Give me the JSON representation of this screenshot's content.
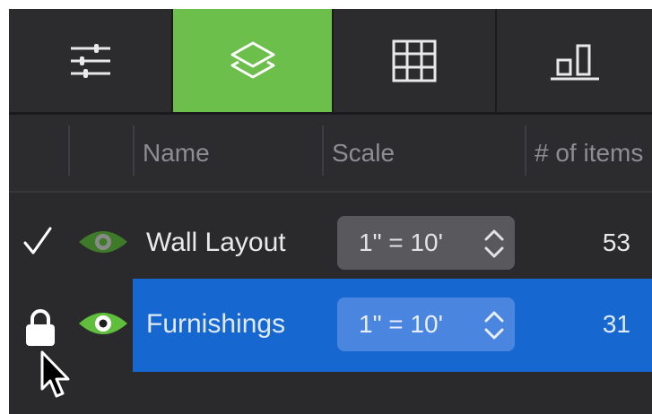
{
  "toolbar": {
    "buttons": [
      {
        "icon": "sliders-icon",
        "active": false
      },
      {
        "icon": "layers-icon",
        "active": true
      },
      {
        "icon": "grid-icon",
        "active": false
      },
      {
        "icon": "bar-chart-icon",
        "active": false
      }
    ],
    "accent": "#6cbf4b"
  },
  "table": {
    "columns": [
      "Name",
      "Scale",
      "# of items"
    ],
    "rows": [
      {
        "name": "Wall Layout",
        "scale": "1\" = 10'",
        "items": "53",
        "visible": true,
        "checked": true,
        "locked": false,
        "selected": false
      },
      {
        "name": "Furnishings",
        "scale": "1\" = 10'",
        "items": "31",
        "visible": true,
        "checked": false,
        "locked": true,
        "selected": true
      }
    ]
  },
  "colors": {
    "panel_bg": "#2a2a2c",
    "selection": "#1767d0",
    "eye_green": "#5fbf3d"
  }
}
